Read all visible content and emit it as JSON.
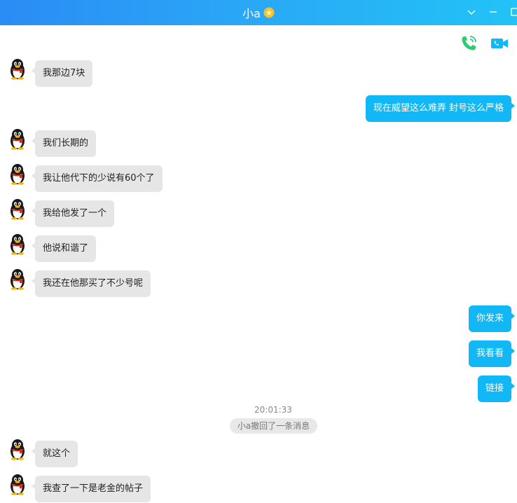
{
  "window": {
    "title": "小a",
    "title_badge_icon": "star-badge-icon",
    "controls": [
      "chevron-down-icon",
      "minimize-icon",
      "maximize-icon"
    ]
  },
  "toolbar": {
    "voice_call_icon": "phone-call-icon",
    "video_call_icon": "video-call-icon"
  },
  "colors": {
    "accent": "#12b7f5",
    "incoming_bubble": "#e6e6e6",
    "call_green": "#2ecc71",
    "title_gradient_start": "#2a8cf5",
    "title_gradient_end": "#22c3f7"
  },
  "messages": [
    {
      "from": "them",
      "text": "我那边7块"
    },
    {
      "from": "me",
      "text": "现在威望这么难弄 封号这么严格"
    },
    {
      "from": "them",
      "text": "我们长期的"
    },
    {
      "from": "them",
      "text": "我让他代下的少说有60个了"
    },
    {
      "from": "them",
      "text": "我给他发了一个"
    },
    {
      "from": "them",
      "text": "他说和谐了"
    },
    {
      "from": "them",
      "text": "我还在他那买了不少号呢"
    },
    {
      "from": "me",
      "text": "你发来"
    },
    {
      "from": "me",
      "text": "我看看"
    },
    {
      "from": "me",
      "text": "链接"
    },
    {
      "from": "them",
      "text": "就这个"
    },
    {
      "from": "them",
      "text": "我查了一下是老金的帖子"
    }
  ],
  "timestamp": "20:01:33",
  "recall_notice": "小a撤回了一条消息"
}
